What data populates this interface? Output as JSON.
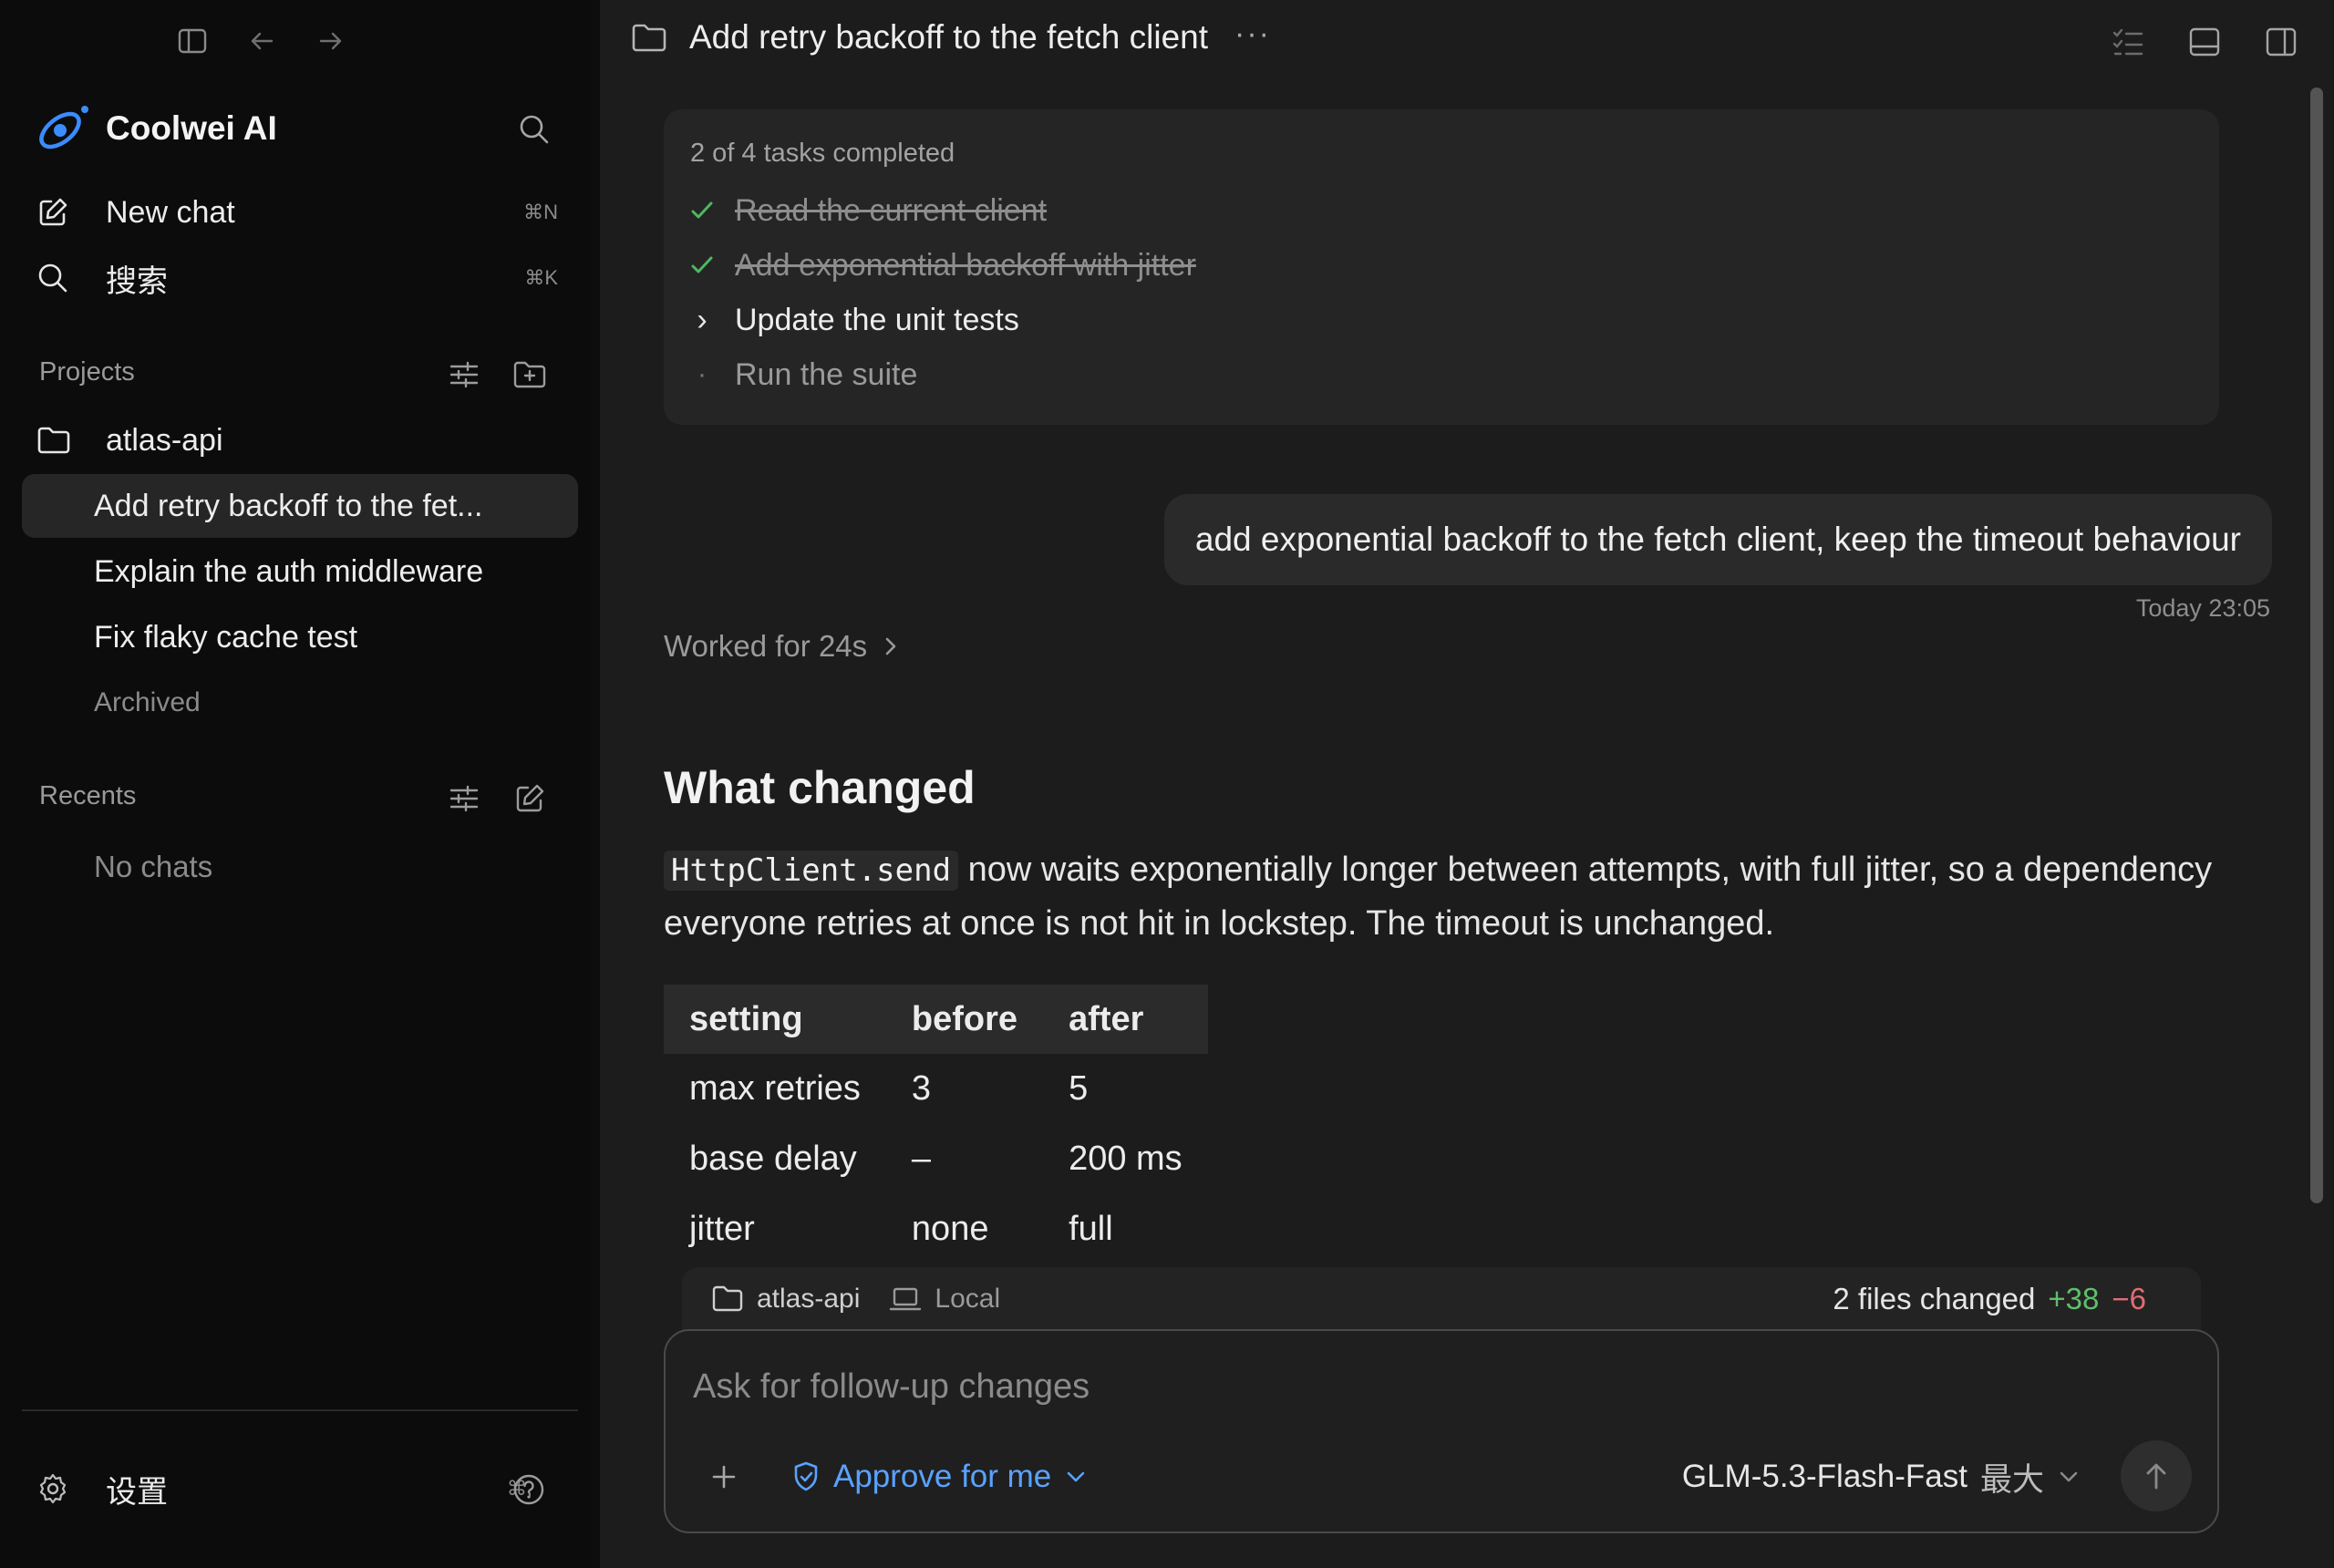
{
  "sidebar": {
    "brand": "Coolwei AI",
    "new_chat": {
      "label": "New chat",
      "shortcut": "⌘N"
    },
    "search": {
      "label": "搜索",
      "shortcut": "⌘K"
    },
    "projects_title": "Projects",
    "project": {
      "name": "atlas-api"
    },
    "chats": [
      "Add retry backoff to the fet...",
      "Explain the auth middleware",
      "Fix flaky cache test"
    ],
    "archived": "Archived",
    "recents_title": "Recents",
    "no_chats": "No chats",
    "settings": {
      "label": "设置",
      "shortcut": "⌘,"
    }
  },
  "header": {
    "title": "Add retry backoff to the fetch client",
    "more": "···"
  },
  "tasks": {
    "summary": "2 of 4 tasks completed",
    "items": [
      {
        "label": "Read the current client",
        "state": "done",
        "marker": "✓"
      },
      {
        "label": "Add exponential backoff with jitter",
        "state": "done",
        "marker": "✓"
      },
      {
        "label": "Update the unit tests",
        "state": "active",
        "marker": "›"
      },
      {
        "label": "Run the suite",
        "state": "pending",
        "marker": "·"
      }
    ]
  },
  "conversation": {
    "user_message": "add exponential backoff to the fetch client, keep the timeout behaviour",
    "timestamp": "Today 23:05",
    "worked": "Worked for 24s",
    "heading": "What changed",
    "code_term": "HttpClient.send",
    "paragraph": " now waits exponentially longer between attempts, with full jitter, so a dependency everyone retries at once is not hit in lockstep. The timeout is unchanged.",
    "table": {
      "headers": [
        "setting",
        "before",
        "after"
      ],
      "rows": [
        [
          "max retries",
          "3",
          "5"
        ],
        [
          "base delay",
          "–",
          "200 ms"
        ],
        [
          "jitter",
          "none",
          "full"
        ]
      ]
    }
  },
  "status_bar": {
    "project": "atlas-api",
    "env": "Local",
    "files_changed": "2 files changed",
    "additions": "+38",
    "deletions": "−6"
  },
  "composer": {
    "placeholder": "Ask for follow-up changes",
    "approval": "Approve for me",
    "model": "GLM-5.3-Flash-Fast",
    "effort": "最大"
  },
  "colors": {
    "accent_blue": "#5aa2ff",
    "add_green": "#5fbf6a",
    "del_red": "#e06c75",
    "check_green": "#4cb860"
  }
}
